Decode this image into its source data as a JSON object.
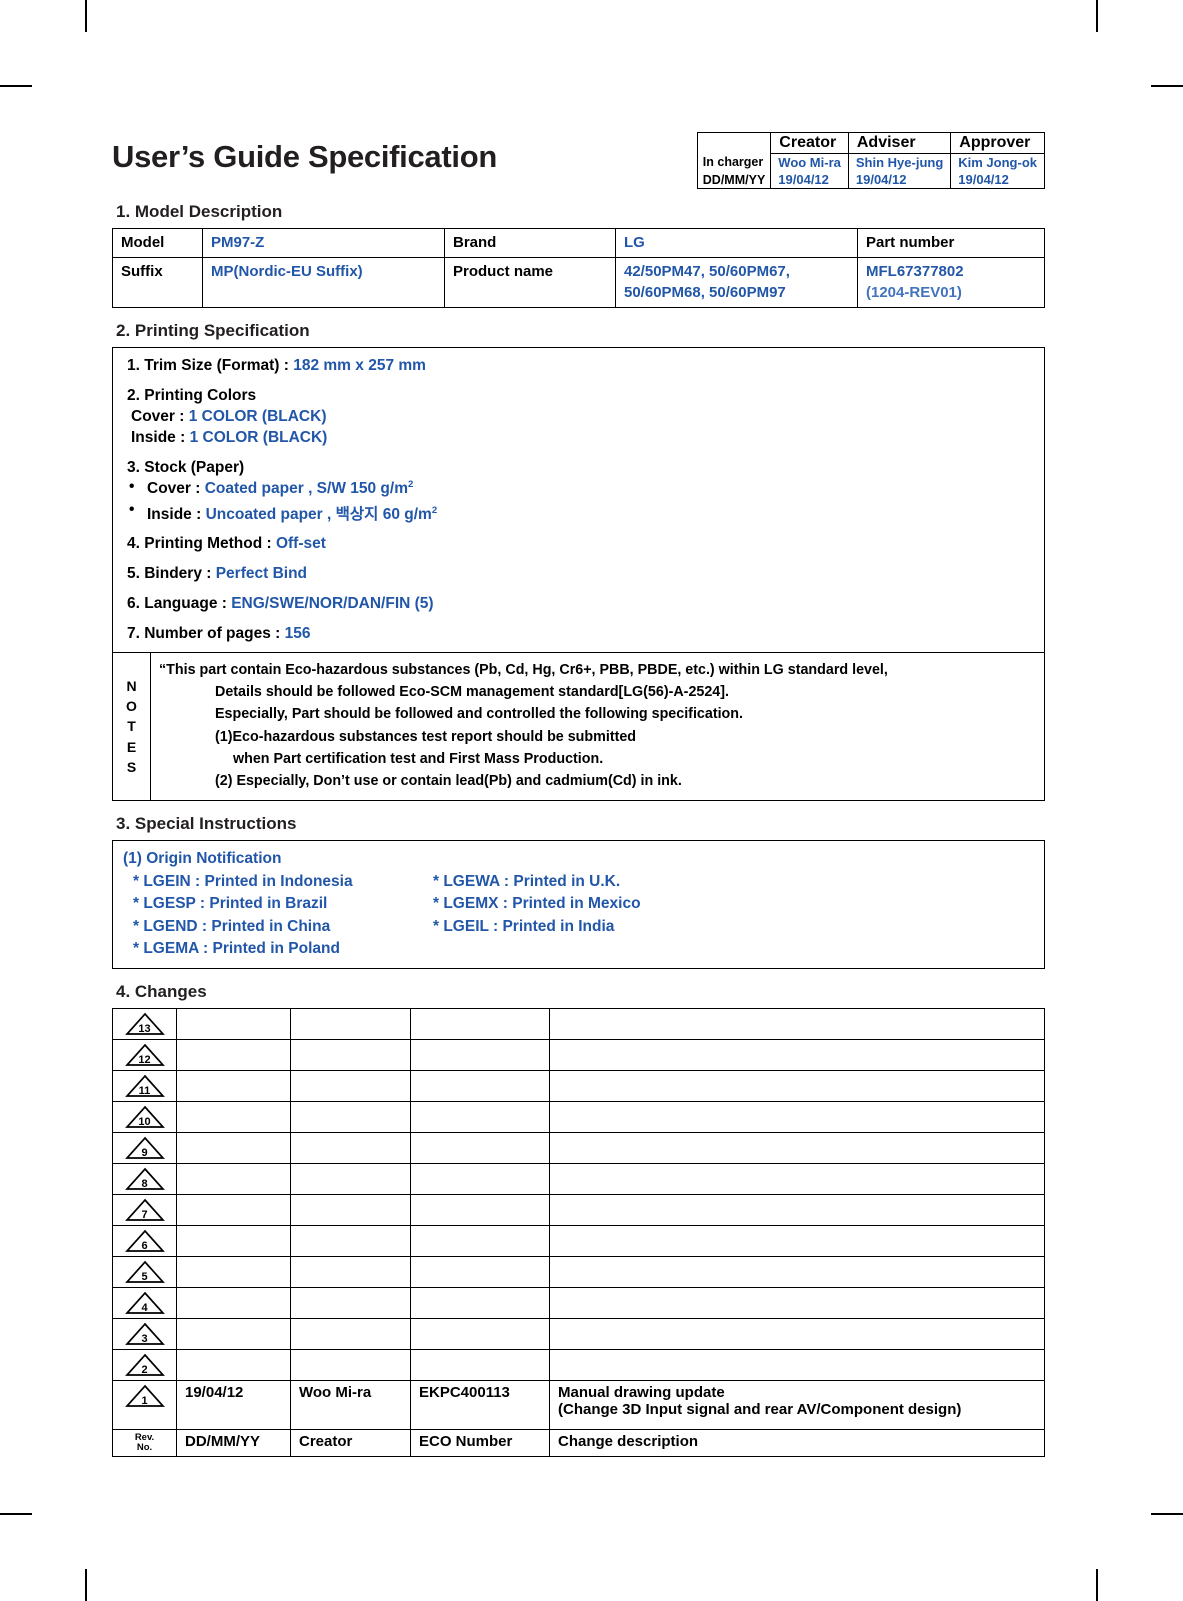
{
  "document": {
    "title": "User’s Guide Specification",
    "accent_blue": "#2156a8",
    "accent_blue_light": "#4273bd"
  },
  "approval": {
    "columns": [
      "",
      "Creator",
      "Adviser",
      "Approver"
    ],
    "rows": [
      {
        "label": "In charger",
        "values": [
          "Woo Mi-ra",
          "Shin Hye-jung",
          "Kim Jong-ok"
        ]
      },
      {
        "label": "DD/MM/YY",
        "values": [
          "19/04/12",
          "19/04/12",
          "19/04/12"
        ]
      }
    ]
  },
  "sections": {
    "model": {
      "heading": "1. Model Description"
    },
    "printing": {
      "heading": "2. Printing Specification"
    },
    "special": {
      "heading": "3. Special Instructions"
    },
    "changes": {
      "heading": "4. Changes"
    }
  },
  "model_table": {
    "model_label": "Model",
    "model_value": "PM97-Z",
    "brand_label": "Brand",
    "brand_value": "LG",
    "partnumber_label": "Part number",
    "suffix_label": "Suffix",
    "suffix_value": "MP(Nordic-EU Suffix)",
    "productname_label": "Product name",
    "productname_value_line1": "42/50PM47, 50/60PM67,",
    "productname_value_line2": "50/60PM68, 50/60PM97",
    "partnumber_value": "MFL67377802",
    "partnumber_rev": "(1204-REV01)"
  },
  "printing": {
    "trim_label": "1. Trim Size (Format) : ",
    "trim_value": "182 mm x 257 mm",
    "colors_label": "2. Printing Colors",
    "colors_cover_label": "Cover : ",
    "colors_cover_value": "1 COLOR (BLACK)",
    "colors_inside_label": "Inside : ",
    "colors_inside_value": "1 COLOR (BLACK)",
    "stock_label": "3. Stock (Paper)",
    "stock_cover_label": "Cover : ",
    "stock_cover_value": "Coated paper , S/W 150 g/m",
    "stock_cover_sup": "2",
    "stock_inside_label": "Inside : ",
    "stock_inside_value": "Uncoated paper , 백상지 60 g/m",
    "stock_inside_sup": "2",
    "method_label": "4. Printing Method : ",
    "method_value": "Off-set",
    "bindery_label": "5. Bindery  : ",
    "bindery_value": "Perfect Bind",
    "language_label": "6. Language : ",
    "language_value": "ENG/SWE/NOR/DAN/FIN (5)",
    "pages_label": "7. Number of pages : ",
    "pages_value": "156"
  },
  "notes": {
    "label_letters": [
      "N",
      "O",
      "T",
      "E",
      "S"
    ],
    "lines": [
      "“This part contain Eco-hazardous substances (Pb, Cd, Hg, Cr6+, PBB, PBDE, etc.) within LG standard level,",
      "Details should be followed Eco-SCM management standard[LG(56)-A-2524].",
      "Especially, Part should be followed and controlled the following specification.",
      "(1)Eco-hazardous substances test report should be submitted",
      "when  Part certification test and First Mass Production.",
      "(2) Especially, Don’t use or contain lead(Pb) and cadmium(Cd) in ink."
    ]
  },
  "special_instructions": {
    "title": "(1) Origin Notification",
    "origins": [
      {
        "left": "* LGEIN : Printed in Indonesia",
        "right": "* LGEWA : Printed in U.K."
      },
      {
        "left": "* LGESP : Printed in Brazil",
        "right": "* LGEMX : Printed in Mexico"
      },
      {
        "left": "* LGEND : Printed in China",
        "right": "* LGEIL : Printed in India"
      },
      {
        "left": "* LGEMA : Printed in Poland",
        "right": ""
      }
    ]
  },
  "changes_table": {
    "rows": [
      {
        "rev": "13",
        "date": "",
        "creator": "",
        "eco": "",
        "desc1": "",
        "desc2": ""
      },
      {
        "rev": "12",
        "date": "",
        "creator": "",
        "eco": "",
        "desc1": "",
        "desc2": ""
      },
      {
        "rev": "11",
        "date": "",
        "creator": "",
        "eco": "",
        "desc1": "",
        "desc2": ""
      },
      {
        "rev": "10",
        "date": "",
        "creator": "",
        "eco": "",
        "desc1": "",
        "desc2": ""
      },
      {
        "rev": "9",
        "date": "",
        "creator": "",
        "eco": "",
        "desc1": "",
        "desc2": ""
      },
      {
        "rev": "8",
        "date": "",
        "creator": "",
        "eco": "",
        "desc1": "",
        "desc2": ""
      },
      {
        "rev": "7",
        "date": "",
        "creator": "",
        "eco": "",
        "desc1": "",
        "desc2": ""
      },
      {
        "rev": "6",
        "date": "",
        "creator": "",
        "eco": "",
        "desc1": "",
        "desc2": ""
      },
      {
        "rev": "5",
        "date": "",
        "creator": "",
        "eco": "",
        "desc1": "",
        "desc2": ""
      },
      {
        "rev": "4",
        "date": "",
        "creator": "",
        "eco": "",
        "desc1": "",
        "desc2": ""
      },
      {
        "rev": "3",
        "date": "",
        "creator": "",
        "eco": "",
        "desc1": "",
        "desc2": ""
      },
      {
        "rev": "2",
        "date": "",
        "creator": "",
        "eco": "",
        "desc1": "",
        "desc2": ""
      },
      {
        "rev": "1",
        "date": "19/04/12",
        "creator": "Woo Mi-ra",
        "eco": "EKPC400113",
        "desc1": "Manual drawing update",
        "desc2": "(Change 3D Input signal and rear AV/Component design)"
      }
    ],
    "header": {
      "rev_line1": "Rev.",
      "rev_line2": "No.",
      "date": "DD/MM/YY",
      "creator": "Creator",
      "eco": "ECO Number",
      "desc": "Change description"
    }
  }
}
